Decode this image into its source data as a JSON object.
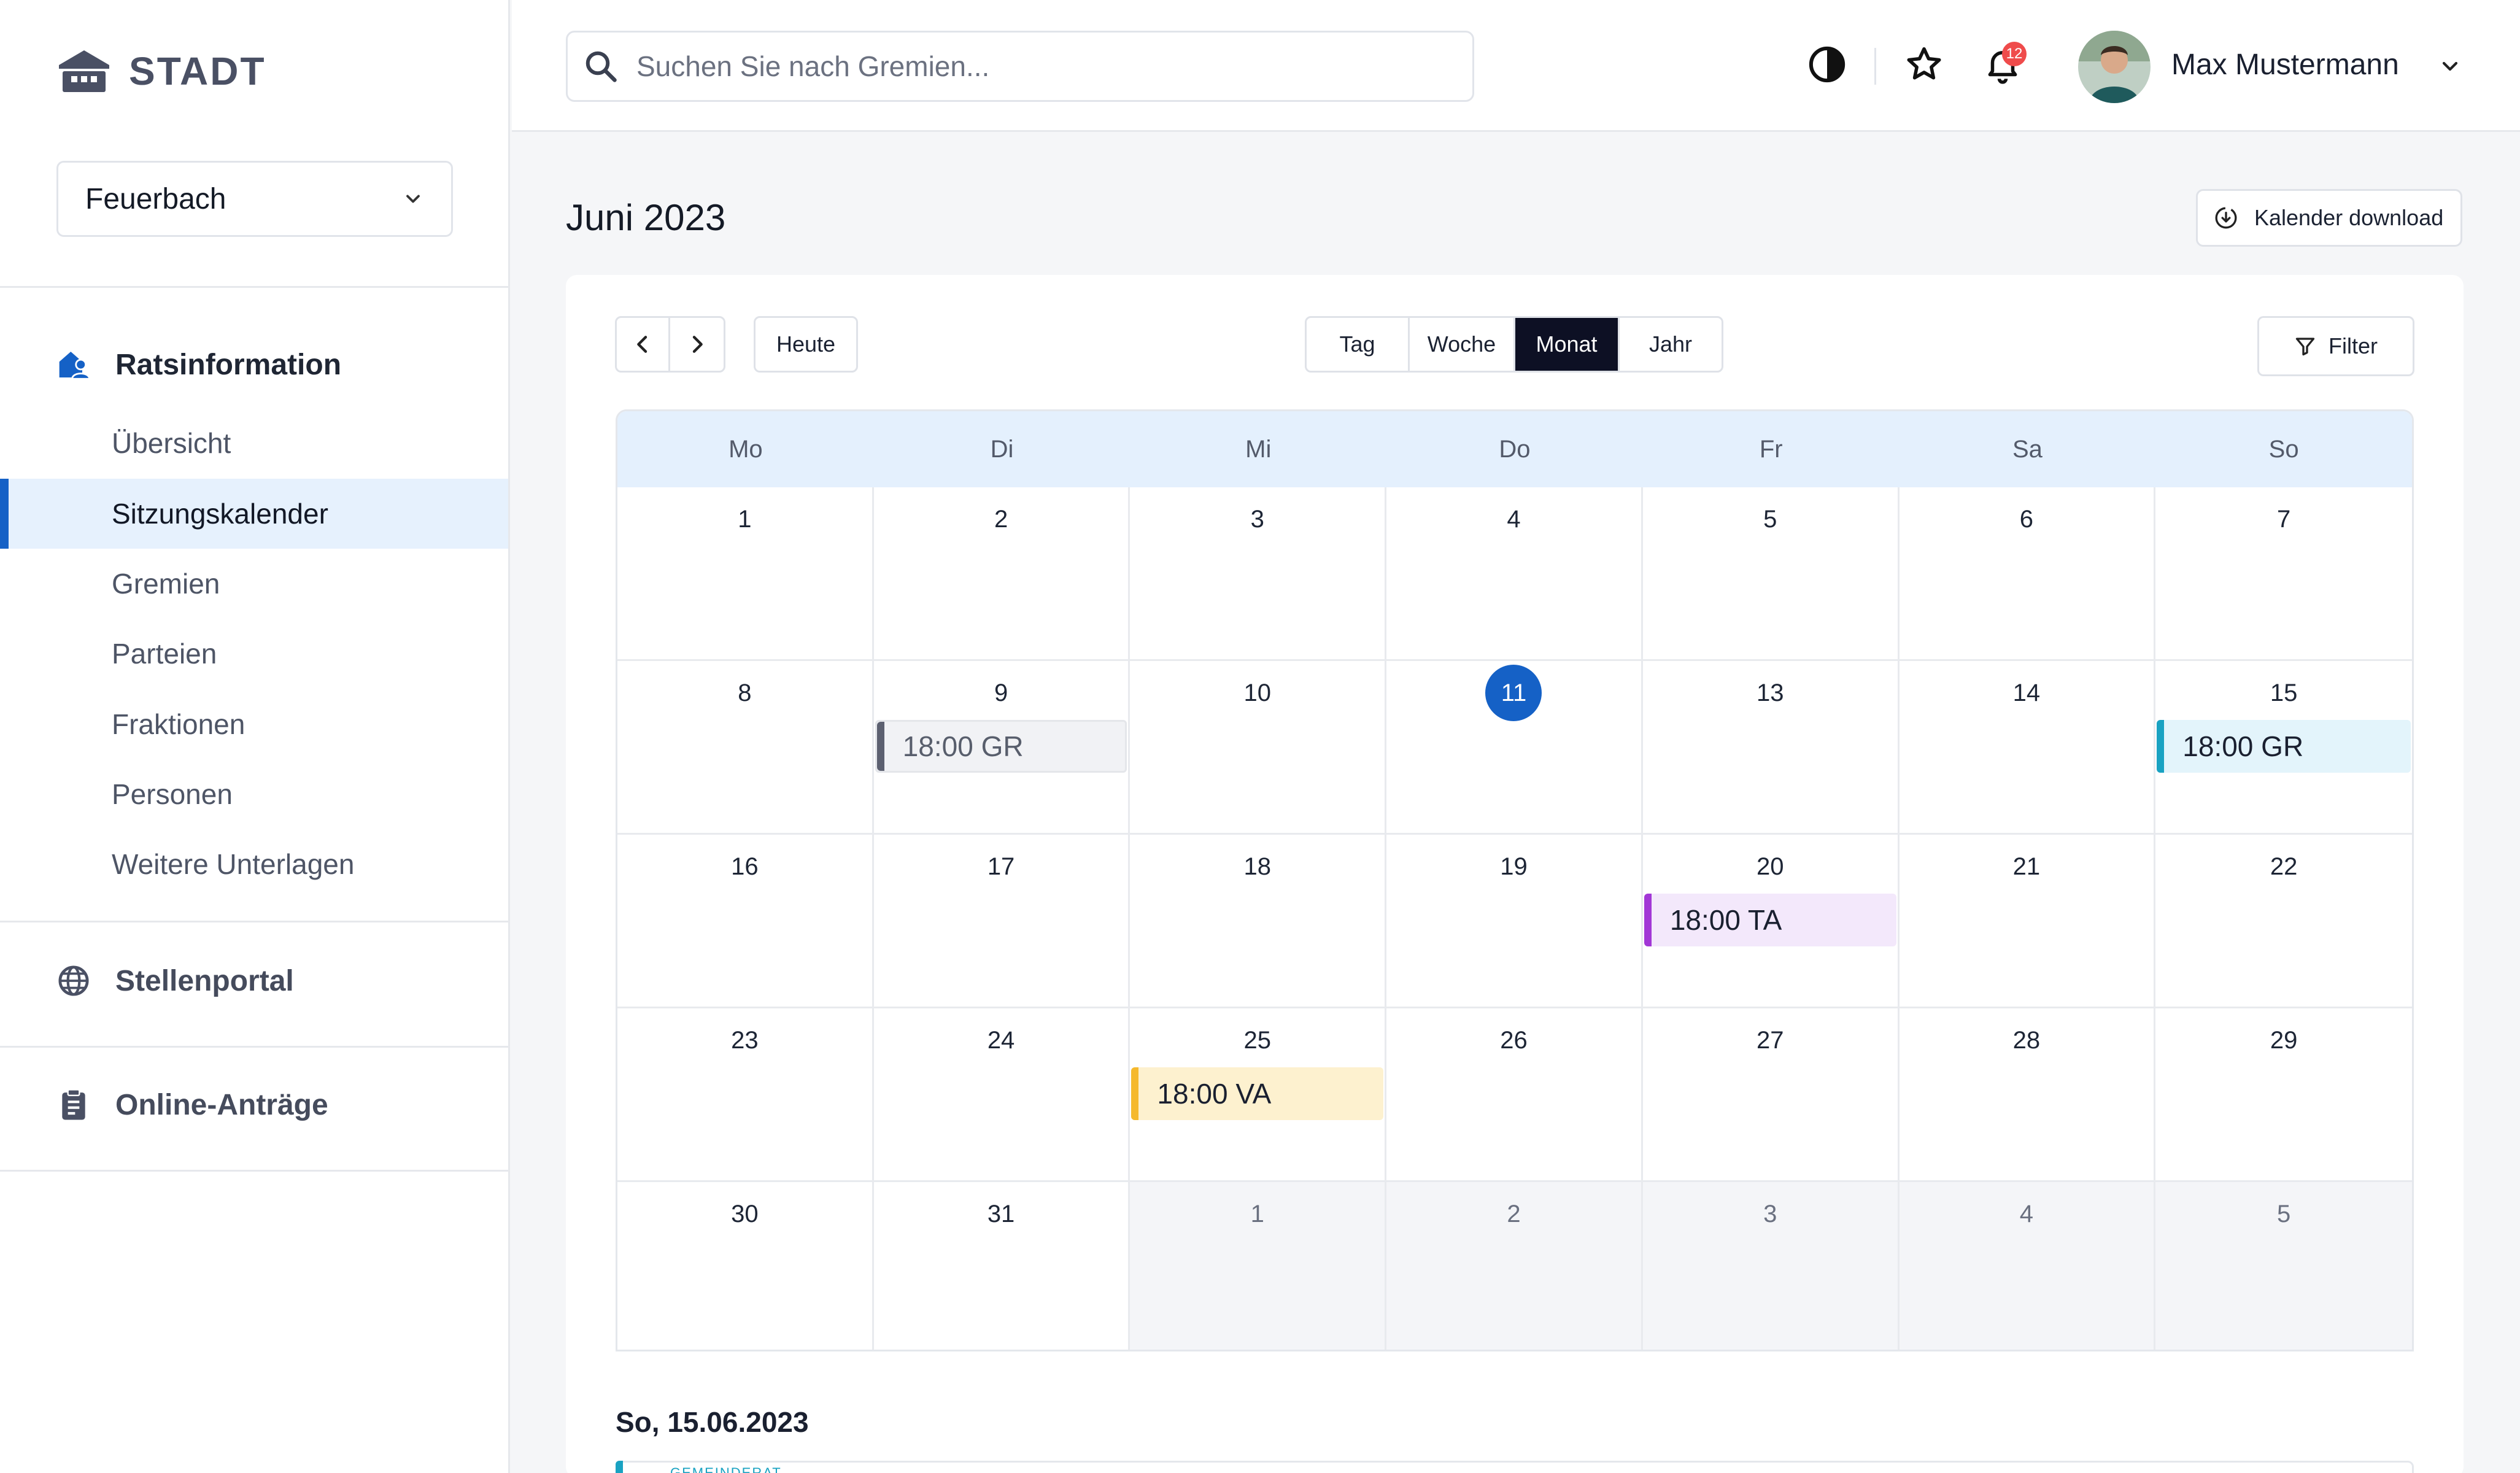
{
  "brand": {
    "name": "STADT"
  },
  "sidebar": {
    "location": "Feuerbach",
    "sections": [
      {
        "label": "Ratsinformation"
      },
      {
        "label": "Stellenportal"
      },
      {
        "label": "Online-Anträge"
      }
    ],
    "items": [
      {
        "label": "Übersicht"
      },
      {
        "label": "Sitzungskalender"
      },
      {
        "label": "Gremien"
      },
      {
        "label": "Parteien"
      },
      {
        "label": "Fraktionen"
      },
      {
        "label": "Personen"
      },
      {
        "label": "Weitere Unterlagen"
      }
    ]
  },
  "header": {
    "search_placeholder": "Suchen Sie nach Gremien...",
    "notification_count": "12",
    "user_name": "Max Mustermann"
  },
  "main": {
    "title": "Juni 2023",
    "download_label": "Kalender download",
    "today_label": "Heute",
    "filter_label": "Filter",
    "views": [
      "Tag",
      "Woche",
      "Monat",
      "Jahr"
    ],
    "active_view": "Monat",
    "weekdays": [
      "Mo",
      "Di",
      "Mi",
      "Do",
      "Fr",
      "Sa",
      "So"
    ],
    "days": [
      {
        "n": "1"
      },
      {
        "n": "2"
      },
      {
        "n": "3"
      },
      {
        "n": "4"
      },
      {
        "n": "5"
      },
      {
        "n": "6"
      },
      {
        "n": "7"
      },
      {
        "n": "8"
      },
      {
        "n": "9",
        "event": "18:00 GR",
        "color": "gray"
      },
      {
        "n": "10"
      },
      {
        "n": "11",
        "today": true
      },
      {
        "n": "13"
      },
      {
        "n": "14"
      },
      {
        "n": "15",
        "event": "18:00 GR",
        "color": "cyan"
      },
      {
        "n": "16"
      },
      {
        "n": "17"
      },
      {
        "n": "18"
      },
      {
        "n": "19"
      },
      {
        "n": "20",
        "event": "18:00 TA",
        "color": "purple"
      },
      {
        "n": "21"
      },
      {
        "n": "22"
      },
      {
        "n": "23"
      },
      {
        "n": "24"
      },
      {
        "n": "25",
        "event": "18:00 VA",
        "color": "yellow"
      },
      {
        "n": "26"
      },
      {
        "n": "27"
      },
      {
        "n": "28"
      },
      {
        "n": "29"
      },
      {
        "n": "30"
      },
      {
        "n": "31"
      },
      {
        "n": "1",
        "other": true
      },
      {
        "n": "2",
        "other": true
      },
      {
        "n": "3",
        "other": true
      },
      {
        "n": "4",
        "other": true
      },
      {
        "n": "5",
        "other": true
      }
    ],
    "selected_date": "So, 15.06.2023",
    "peek_label": "GEMEINDERAT"
  },
  "colors": {
    "accent": "#1561c6",
    "active_view": "#0d1024",
    "badge": "#ef4b4b"
  }
}
